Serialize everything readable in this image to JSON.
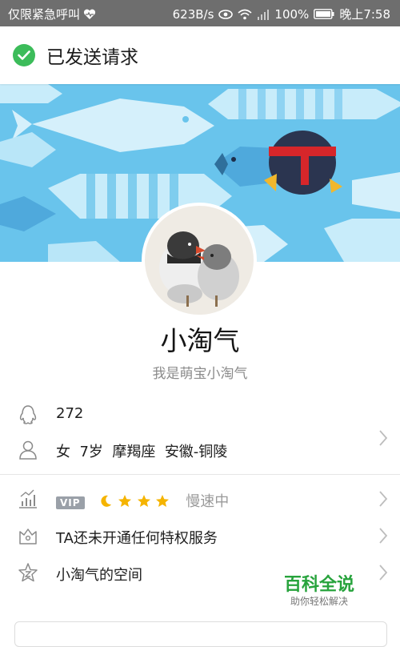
{
  "status_bar": {
    "carrier_text": "仅限紧急呼叫",
    "speed": "623B/s",
    "battery": "100%",
    "time": "晚上7:58"
  },
  "toast": {
    "message": "已发送请求",
    "icon": "check-circle-icon"
  },
  "profile": {
    "nickname": "小淘气",
    "signature": "我是萌宝小淘气"
  },
  "info": {
    "qq_number_partial": "272",
    "gender": "女",
    "age": "7岁",
    "zodiac": "摩羯座",
    "location": "安徽-铜陵"
  },
  "vip": {
    "badge": "VIP",
    "level_icons": [
      "moon-icon",
      "star-icon",
      "star-icon",
      "star-icon"
    ],
    "status": "慢速中"
  },
  "privilege": {
    "label": "TA还未开通任何特权服务"
  },
  "space": {
    "label": "小淘气的空间"
  },
  "watermark": {
    "title": "百科全说",
    "subtitle": "助你轻松解决"
  },
  "colors": {
    "accent_green": "#3cbc5a",
    "cover_blue": "#68c3eb",
    "star": "#f5b400"
  }
}
